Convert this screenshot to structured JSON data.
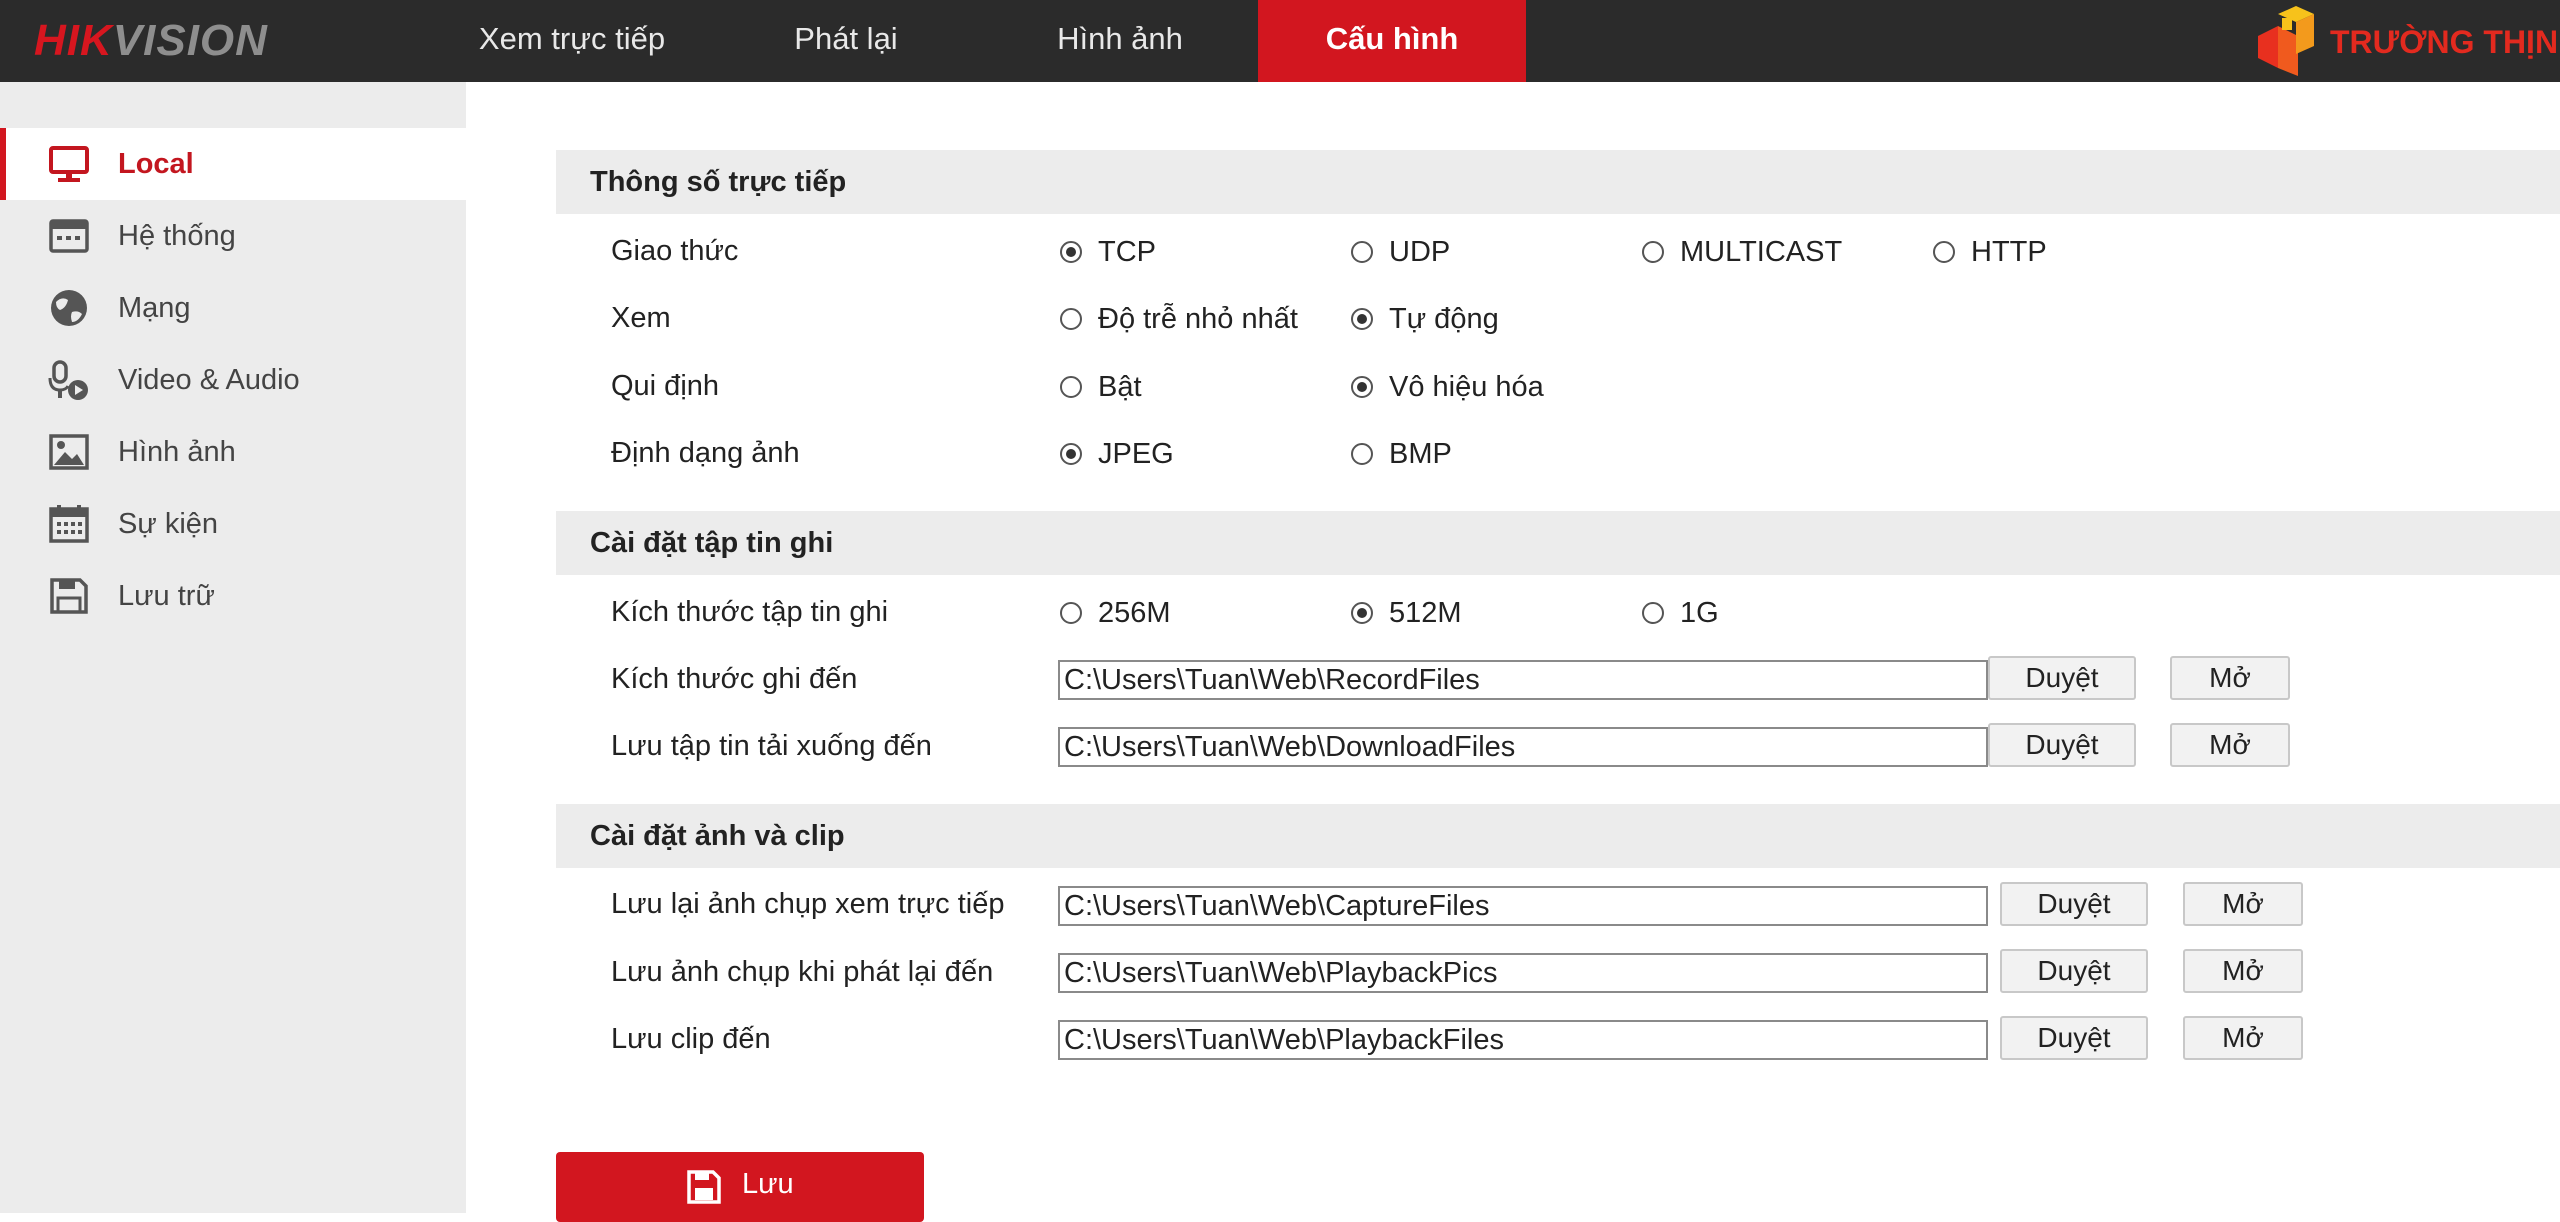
{
  "brand": {
    "part1": "HIK",
    "part2": "VISION"
  },
  "partner_logo": {
    "text": "TRƯỜNG THỊNH"
  },
  "nav": [
    {
      "label": "Xem trực tiếp"
    },
    {
      "label": "Phát lại"
    },
    {
      "label": "Hình ảnh"
    },
    {
      "label": "Cấu hình",
      "active": true
    }
  ],
  "sidebar": {
    "items": [
      {
        "label": "Local",
        "icon": "monitor-icon",
        "active": true
      },
      {
        "label": "Hệ thống",
        "icon": "system-icon"
      },
      {
        "label": "Mạng",
        "icon": "globe-icon"
      },
      {
        "label": "Video & Audio",
        "icon": "microphone-icon"
      },
      {
        "label": "Hình ảnh",
        "icon": "image-icon"
      },
      {
        "label": "Sự kiện",
        "icon": "calendar-icon"
      },
      {
        "label": "Lưu trữ",
        "icon": "floppy-disk-icon"
      }
    ]
  },
  "live_params": {
    "title": "Thông số trực tiếp",
    "protocol": {
      "label": "Giao thức",
      "options": [
        "TCP",
        "UDP",
        "MULTICAST",
        "HTTP"
      ],
      "selected": "TCP"
    },
    "view": {
      "label": "Xem",
      "options": [
        "Độ trễ nhỏ nhất",
        "Tự động"
      ],
      "selected": "Tự động"
    },
    "rule": {
      "label": "Qui định",
      "options": [
        "Bật",
        "Vô hiệu hóa"
      ],
      "selected": "Vô hiệu hóa"
    },
    "image_format": {
      "label": "Định dạng ảnh",
      "options": [
        "JPEG",
        "BMP"
      ],
      "selected": "JPEG"
    }
  },
  "record_settings": {
    "title": "Cài đặt tập tin ghi",
    "file_size": {
      "label": "Kích thước tập tin ghi",
      "options": [
        "256M",
        "512M",
        "1G"
      ],
      "selected": "512M"
    },
    "save_to": {
      "label": "Kích thước ghi đến",
      "value": "C:\\Users\\Tuan\\Web\\RecordFiles"
    },
    "download_to": {
      "label": "Lưu tập tin tải xuống đến",
      "value": "C:\\Users\\Tuan\\Web\\DownloadFiles"
    }
  },
  "capture_settings": {
    "title": "Cài đặt ảnh và clip",
    "live_snapshot": {
      "label": "Lưu lại ảnh chụp xem trực tiếp",
      "value": "C:\\Users\\Tuan\\Web\\CaptureFiles"
    },
    "playback_snapshot": {
      "label": "Lưu ảnh chụp khi phát lại đến",
      "value": "C:\\Users\\Tuan\\Web\\PlaybackPics"
    },
    "clip": {
      "label": "Lưu clip đến",
      "value": "C:\\Users\\Tuan\\Web\\PlaybackFiles"
    }
  },
  "buttons": {
    "browse": "Duyệt",
    "open": "Mở",
    "save": "Lưu"
  },
  "colors": {
    "accent": "#d2161f",
    "topbar": "#2b2b2b",
    "sidebar": "#ececec"
  }
}
